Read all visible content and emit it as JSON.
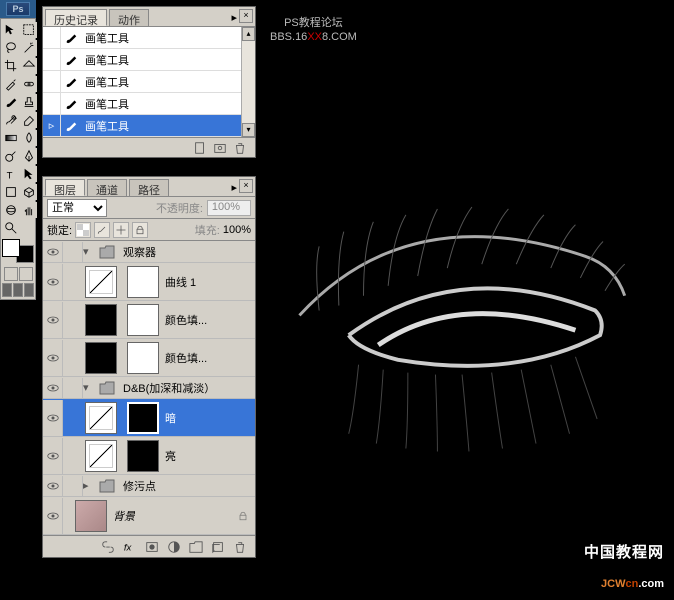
{
  "app": {
    "logo": "Ps"
  },
  "watermark1": {
    "line1": "PS教程论坛",
    "line2a": "BBS.16",
    "line2b": "XX",
    "line2c": "8.COM"
  },
  "watermark2": {
    "cn": "中国教程网",
    "en1": "JCW",
    "en2": "cn",
    "en3": ".com"
  },
  "historyPanel": {
    "tabs": {
      "history": "历史记录",
      "actions": "动作"
    },
    "items": [
      {
        "label": "画笔工具",
        "selected": false
      },
      {
        "label": "画笔工具",
        "selected": false
      },
      {
        "label": "画笔工具",
        "selected": false
      },
      {
        "label": "画笔工具",
        "selected": false
      },
      {
        "label": "画笔工具",
        "selected": true
      }
    ]
  },
  "layersPanel": {
    "tabs": {
      "layers": "图层",
      "channels": "通道",
      "paths": "路径"
    },
    "blendMode": "正常",
    "opacityLabel": "不透明度:",
    "opacityValue": "100%",
    "lockLabel": "锁定:",
    "fillLabel": "填充:",
    "fillValue": "100%",
    "groups": {
      "g1": {
        "name": "观察器"
      },
      "g2": {
        "name": "D&B(加深和减淡）"
      }
    },
    "layers": {
      "l1": {
        "name": "曲线 1"
      },
      "l2": {
        "name": "颜色填..."
      },
      "l3": {
        "name": "颜色填..."
      },
      "l4": {
        "name": "暗"
      },
      "l5": {
        "name": "亮"
      },
      "l6": {
        "name": "修污点"
      },
      "l7": {
        "name": "背景"
      }
    }
  }
}
